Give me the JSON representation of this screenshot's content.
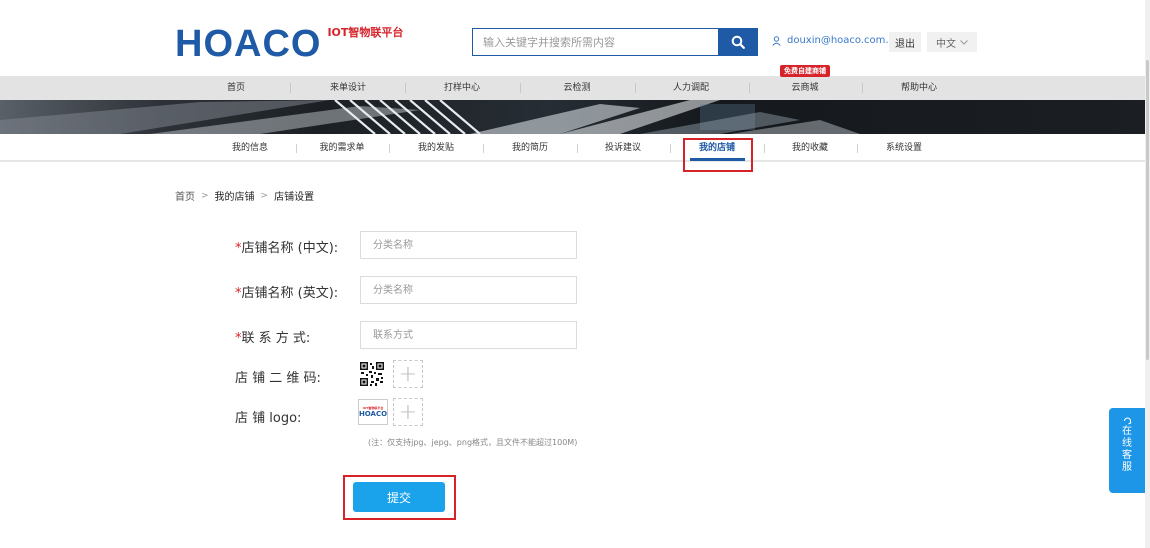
{
  "header": {
    "logo_text": "HOACO",
    "logo_sub": "IOT智物联平台",
    "search_placeholder": "输入关键字并搜索所需内容",
    "user_email": "douxin@hoaco.com.cn",
    "logout_label": "退出",
    "language": "中文"
  },
  "nav": {
    "items": [
      "首页",
      "来单设计",
      "打样中心",
      "云检测",
      "人力调配",
      "云商城",
      "帮助中心"
    ],
    "badge": "免费自建商铺"
  },
  "subtabs": {
    "items": [
      "我的信息",
      "我的需求单",
      "我的发贴",
      "我的简历",
      "投诉建议",
      "我的店铺",
      "我的收藏",
      "系统设置"
    ],
    "active": "我的店铺"
  },
  "breadcrumb": [
    "首页",
    "我的店铺",
    "店铺设置"
  ],
  "form": {
    "name_cn_label": "店铺名称 (中文):",
    "name_cn_placeholder": "分类名称",
    "name_en_label": "店铺名称 (英文):",
    "name_en_placeholder": "分类名称",
    "contact_label": "联 系 方 式:",
    "contact_placeholder": "联系方式",
    "qrcode_label": "店 铺 二 维 码:",
    "logo_label": "店 铺 logo:",
    "logo_thumb_top": "IOT智物联平台",
    "logo_thumb_main": "HOACO",
    "note": "(注：仅支持jpg、jepg、png格式，且文件不能超过100M)",
    "submit_label": "提交"
  },
  "service": {
    "chars": [
      "在",
      "线",
      "客",
      "服"
    ]
  },
  "colors": {
    "brand_blue": "#1f5aa6",
    "submit_blue": "#1aa3ea",
    "highlight_red": "#d6232a"
  }
}
